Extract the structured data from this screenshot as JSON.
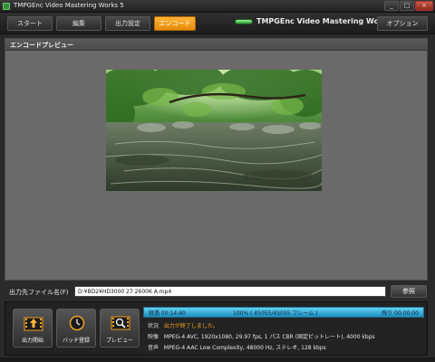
{
  "window": {
    "title": "TMPGEnc Video Mastering Works 5",
    "buttons": [
      "_",
      "□",
      "×"
    ]
  },
  "tabs": [
    {
      "label": "スタート",
      "active": false
    },
    {
      "label": "編集",
      "active": false
    },
    {
      "label": "出力設定",
      "active": false
    },
    {
      "label": "エンコード",
      "active": true
    }
  ],
  "brand": {
    "name": "TMPGEnc Video Mastering Works 5"
  },
  "options_label": "オプション",
  "panel": {
    "title": "エンコードプレビュー"
  },
  "output": {
    "label": "出力先ファイル名(F)",
    "value": "D:¥BD2¥HD3000 27 2600K A.mp4",
    "browse_label": "参照"
  },
  "actions": [
    {
      "label": "出力開始",
      "icon": "film-export-icon"
    },
    {
      "label": "バッチ登録",
      "icon": "clock-icon"
    },
    {
      "label": "プレビュー",
      "icon": "film-magnifier-icon"
    }
  ],
  "progress": {
    "elapsed": "経過 00:14:40",
    "percent_text": "100% ( 45055/45055 フレーム )",
    "remaining": "残り 00:00:00",
    "fraction": 1.0
  },
  "info": [
    {
      "key": "状況",
      "value": "出力が終了しました。",
      "warn": true
    },
    {
      "key": "映像",
      "value": "MPEG-4 AVC, 1920x1080, 29.97 fps, 1 パス CBR (固定ビットレート), 4000 kbps",
      "warn": false
    },
    {
      "key": "音声",
      "value": "MPEG-4 AAC Low Complexity, 48000 Hz, ステレオ, 128 kbps",
      "warn": false
    }
  ],
  "colors": {
    "active_tab": "#f29a1c",
    "progress": "#34a9dd",
    "status_warn": "#f0a020"
  }
}
